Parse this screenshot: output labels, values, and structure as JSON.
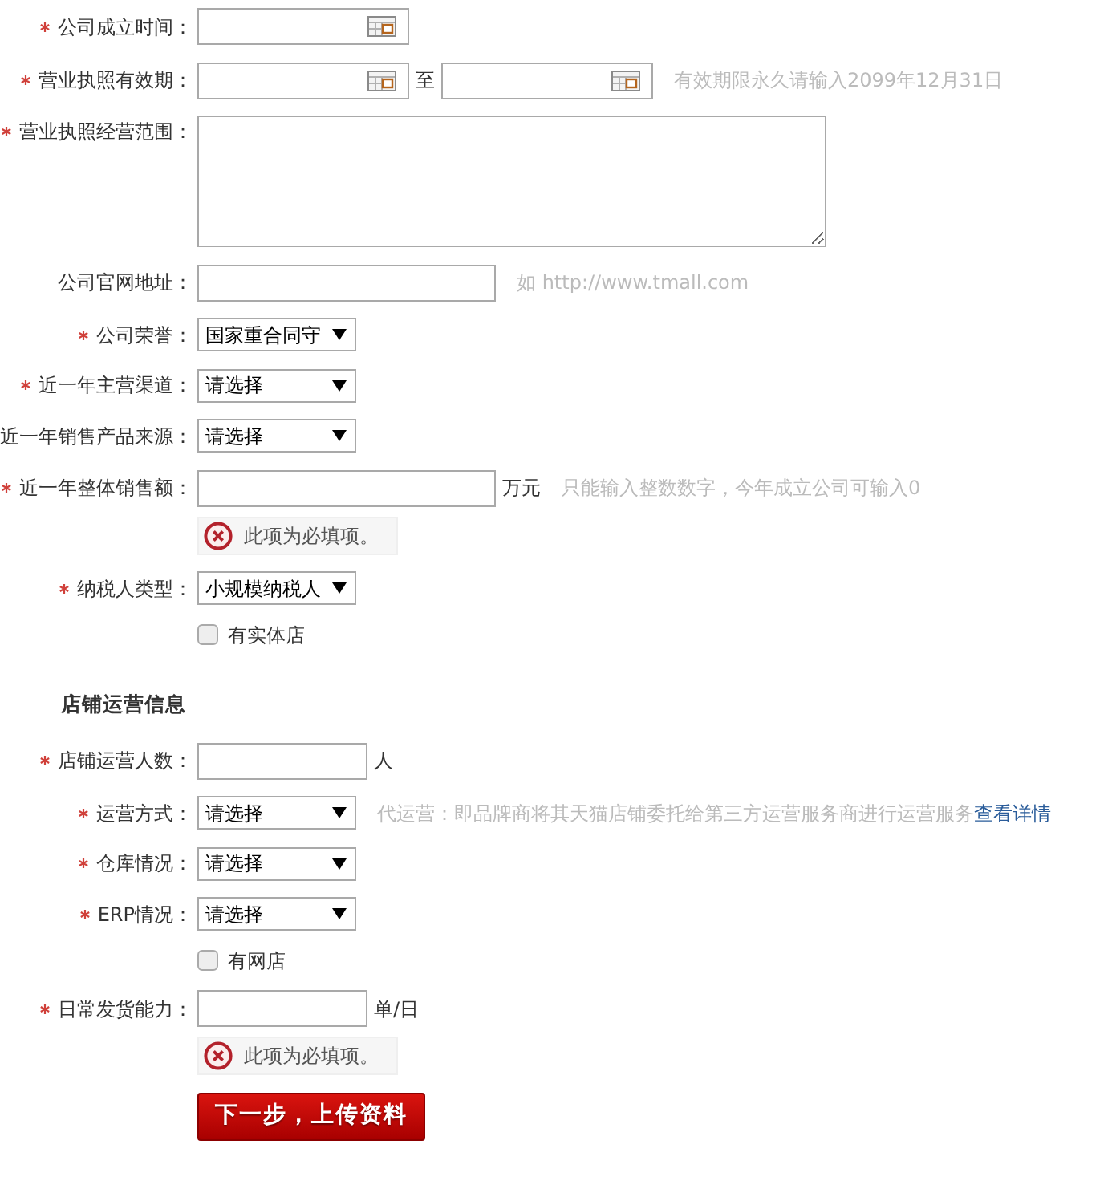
{
  "company_info": {
    "fields": [
      {
        "kind": "date",
        "label": "公司成立时间：",
        "required": true
      },
      {
        "kind": "date_range",
        "label": "营业执照有效期：",
        "required": true,
        "separator": "至",
        "hint": "有效期限永久请输入2099年12月31日"
      },
      {
        "kind": "textarea",
        "label": "营业执照经营范围：",
        "required": true
      },
      {
        "kind": "text",
        "label": "公司官网地址：",
        "required": false,
        "hint": "如 http://www.tmall.com"
      },
      {
        "kind": "select",
        "label": "公司荣誉：",
        "required": true,
        "value": "国家重合同守"
      },
      {
        "kind": "select",
        "label": "近一年主营渠道：",
        "required": true,
        "value": "请选择"
      },
      {
        "kind": "select",
        "label": "近一年销售产品来源：",
        "required": false,
        "value": "请选择"
      },
      {
        "kind": "text",
        "label": "近一年整体销售额：",
        "required": true,
        "unit": "万元",
        "hint": "只能输入整数数字，今年成立公司可输入0",
        "error": "此项为必填项。"
      },
      {
        "kind": "select",
        "label": "纳税人类型：",
        "required": true,
        "value": "小规模纳税人"
      },
      {
        "kind": "checkbox",
        "label": "有实体店",
        "checked": false
      }
    ]
  },
  "shop_info": {
    "title": "店铺运营信息",
    "fields": [
      {
        "kind": "text",
        "label": "店铺运营人数：",
        "required": true,
        "unit": "人"
      },
      {
        "kind": "select",
        "label": "运营方式：",
        "required": true,
        "value": "请选择",
        "hint": "代运营：即品牌商将其天猫店铺委托给第三方运营服务商进行运营服务",
        "link": "查看详情"
      },
      {
        "kind": "select",
        "label": "仓库情况：",
        "required": true,
        "value": "请选择"
      },
      {
        "kind": "select",
        "label": "ERP情况：",
        "required": true,
        "value": "请选择"
      },
      {
        "kind": "checkbox",
        "label": "有网店",
        "checked": false
      },
      {
        "kind": "text",
        "label": "日常发货能力：",
        "required": true,
        "unit": "单/日",
        "error": "此项为必填项。"
      }
    ]
  },
  "submit_button": {
    "label": "下一步，上传资料"
  }
}
